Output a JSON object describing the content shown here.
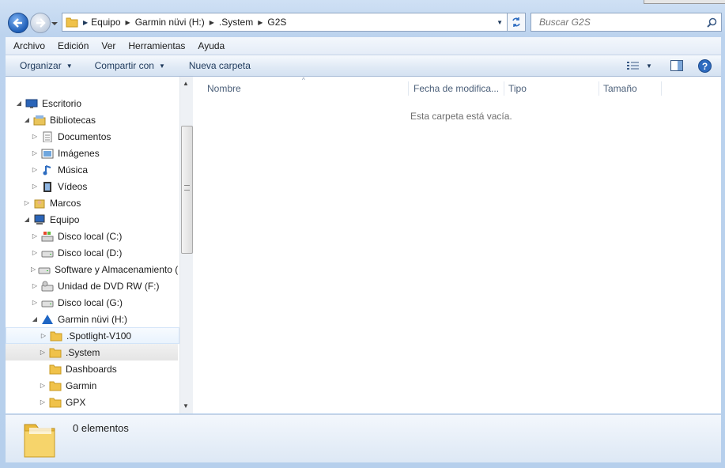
{
  "address": {
    "crumbs": [
      "Equipo",
      "Garmin nüvi (H:)",
      ".System",
      "G2S"
    ]
  },
  "search": {
    "placeholder": "Buscar G2S"
  },
  "menu": [
    "Archivo",
    "Edición",
    "Ver",
    "Herramientas",
    "Ayuda"
  ],
  "commands": {
    "organize": "Organizar",
    "share": "Compartir con",
    "new_folder": "Nueva carpeta"
  },
  "tree": [
    {
      "label": "Escritorio",
      "icon": "desktop-icon",
      "expander": "open"
    },
    {
      "label": "Bibliotecas",
      "icon": "libraries-icon",
      "expander": "open"
    },
    {
      "label": "Documentos",
      "icon": "documents-icon",
      "expander": "closed"
    },
    {
      "label": "Imágenes",
      "icon": "pictures-icon",
      "expander": "closed"
    },
    {
      "label": "Música",
      "icon": "music-icon",
      "expander": "closed"
    },
    {
      "label": "Vídeos",
      "icon": "videos-icon",
      "expander": "closed"
    },
    {
      "label": "Marcos",
      "icon": "user-icon",
      "expander": "closed"
    },
    {
      "label": "Equipo",
      "icon": "computer-icon",
      "expander": "open"
    },
    {
      "label": "Disco local (C:)",
      "icon": "system-drive-icon",
      "expander": "closed"
    },
    {
      "label": "Disco local (D:)",
      "icon": "drive-icon",
      "expander": "closed"
    },
    {
      "label": "Software y Almacenamiento (",
      "icon": "drive-icon",
      "expander": "closed"
    },
    {
      "label": "Unidad de DVD RW (F:)",
      "icon": "dvd-drive-icon",
      "expander": "closed"
    },
    {
      "label": "Disco local (G:)",
      "icon": "drive-icon",
      "expander": "closed"
    },
    {
      "label": "Garmin nüvi (H:)",
      "icon": "garmin-drive-icon",
      "expander": "open"
    },
    {
      "label": ".Spotlight-V100",
      "icon": "folder-icon",
      "expander": "closed"
    },
    {
      "label": ".System",
      "icon": "folder-icon",
      "expander": "closed"
    },
    {
      "label": "Dashboards",
      "icon": "folder-icon",
      "expander": "none"
    },
    {
      "label": "Garmin",
      "icon": "folder-icon",
      "expander": "closed"
    },
    {
      "label": "GPX",
      "icon": "folder-icon",
      "expander": "closed"
    }
  ],
  "columns": [
    "Nombre",
    "Fecha de modifica...",
    "Tipo",
    "Tamaño"
  ],
  "empty_message": "Esta carpeta está vacía.",
  "details": {
    "count": "0 elementos"
  },
  "colors": {
    "accent": "#1e395b",
    "folder": "#f0c24a"
  }
}
